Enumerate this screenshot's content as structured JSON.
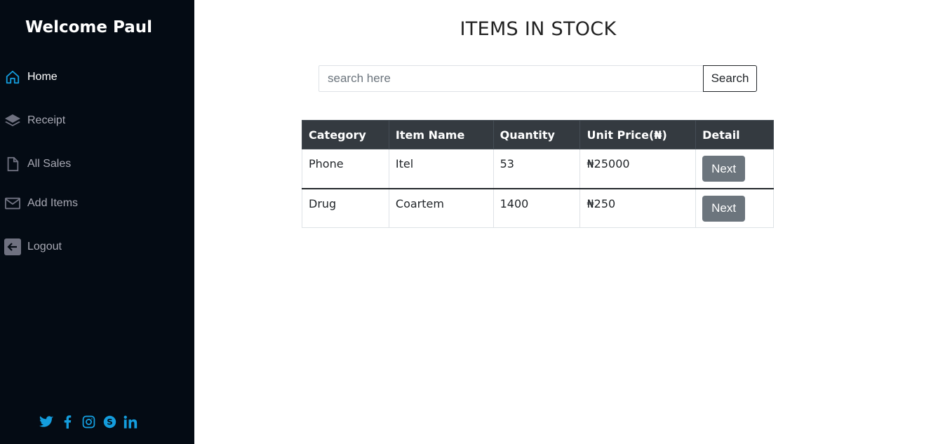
{
  "sidebar": {
    "welcome": "Welcome Paul",
    "accent_color": "#149ddd",
    "items": [
      {
        "label": "Home",
        "icon": "home-icon"
      },
      {
        "label": "Receipt",
        "icon": "layers-icon"
      },
      {
        "label": "All Sales",
        "icon": "file-icon"
      },
      {
        "label": "Add Items",
        "icon": "envelope-icon"
      },
      {
        "label": "Logout",
        "icon": "arrow-left-square-icon"
      }
    ],
    "social": [
      "twitter-icon",
      "facebook-icon",
      "instagram-icon",
      "skype-icon",
      "linkedin-icon"
    ]
  },
  "main": {
    "title": "ITEMS IN STOCK",
    "search": {
      "placeholder": "search here",
      "value": "",
      "button": "Search"
    },
    "table": {
      "headers": [
        "Category",
        "Item Name",
        "Quantity",
        "Unit Price(₦)",
        "Detail"
      ],
      "rows": [
        {
          "category": "Phone",
          "item_name": "Itel",
          "quantity": "53",
          "unit_price": "₦25000",
          "detail": "Next"
        },
        {
          "category": "Drug",
          "item_name": "Coartem",
          "quantity": "1400",
          "unit_price": "₦250",
          "detail": "Next"
        }
      ]
    }
  }
}
